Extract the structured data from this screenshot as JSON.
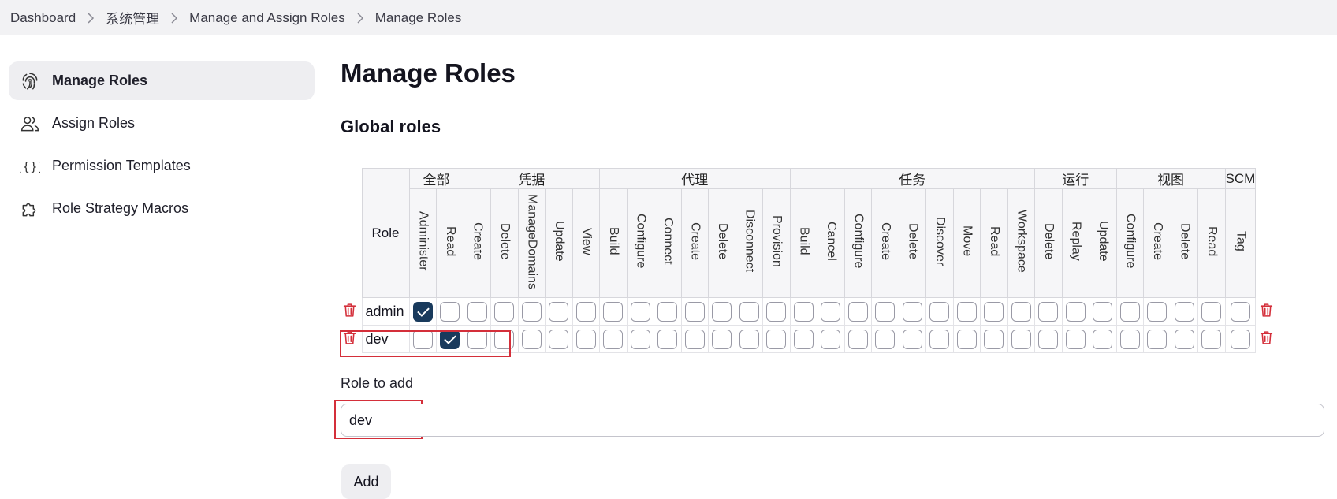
{
  "breadcrumb": [
    {
      "label": "Dashboard"
    },
    {
      "label": "系统管理"
    },
    {
      "label": "Manage and Assign Roles"
    },
    {
      "label": "Manage Roles"
    }
  ],
  "sidebar": {
    "items": [
      {
        "label": "Manage Roles",
        "icon": "fingerprint-icon",
        "active": true
      },
      {
        "label": "Assign Roles",
        "icon": "users-icon",
        "active": false
      },
      {
        "label": "Permission Templates",
        "icon": "template-braces-icon",
        "active": false
      },
      {
        "label": "Role Strategy Macros",
        "icon": "puzzle-icon",
        "active": false
      }
    ]
  },
  "page": {
    "title": "Manage Roles",
    "section_title": "Global roles"
  },
  "table": {
    "role_header": "Role",
    "groups": [
      {
        "label": "全部",
        "perms": [
          "Administer",
          "Read"
        ]
      },
      {
        "label": "凭据",
        "perms": [
          "Create",
          "Delete",
          "ManageDomains",
          "Update",
          "View"
        ]
      },
      {
        "label": "代理",
        "perms": [
          "Build",
          "Configure",
          "Connect",
          "Create",
          "Delete",
          "Disconnect",
          "Provision"
        ]
      },
      {
        "label": "任务",
        "perms": [
          "Build",
          "Cancel",
          "Configure",
          "Create",
          "Delete",
          "Discover",
          "Move",
          "Read",
          "Workspace"
        ]
      },
      {
        "label": "运行",
        "perms": [
          "Delete",
          "Replay",
          "Update"
        ]
      },
      {
        "label": "视图",
        "perms": [
          "Configure",
          "Create",
          "Delete",
          "Read"
        ]
      },
      {
        "label": "SCM",
        "perms": [
          "Tag"
        ]
      }
    ],
    "rows": [
      {
        "role": "admin",
        "checked": [
          "Administer"
        ]
      },
      {
        "role": "dev",
        "checked": [
          "Read"
        ]
      }
    ]
  },
  "add_role": {
    "label": "Role to add",
    "value": "dev",
    "button_label": "Add"
  },
  "colors": {
    "checked_fill": "#193a5c",
    "trash": "#d42f3a",
    "highlight_box": "#d42f3a"
  }
}
